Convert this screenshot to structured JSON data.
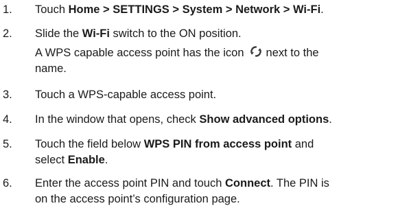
{
  "steps": [
    {
      "number": "1.",
      "pre": "Touch ",
      "path": "Home > SETTINGS > System > Network > Wi-Fi",
      "post": "."
    },
    {
      "number": "2.",
      "pre": "Slide the ",
      "bold": "Wi-Fi",
      "post": " switch to the ON position.",
      "note_pre": "A WPS capable access point has the icon",
      "note_icon": "wps-icon",
      "note_post": "next to the",
      "note_line2": "name."
    },
    {
      "number": "3.",
      "text": "Touch a WPS-capable access point."
    },
    {
      "number": "4.",
      "pre": "In the window that opens, check ",
      "bold": "Show advanced options",
      "post": "."
    },
    {
      "number": "5.",
      "pre": "Touch the field below ",
      "bold": "WPS PIN from access point",
      "post": " and",
      "line2_pre": "select ",
      "line2_bold": "Enable",
      "line2_post": "."
    },
    {
      "number": "6.",
      "pre": "Enter the access point PIN and touch ",
      "bold": "Connect",
      "post": ". The PIN is",
      "line2": "on the access point’s configuration page."
    }
  ],
  "colors": {
    "text": "#1a1a1a",
    "icon": "#3c3c3c"
  }
}
